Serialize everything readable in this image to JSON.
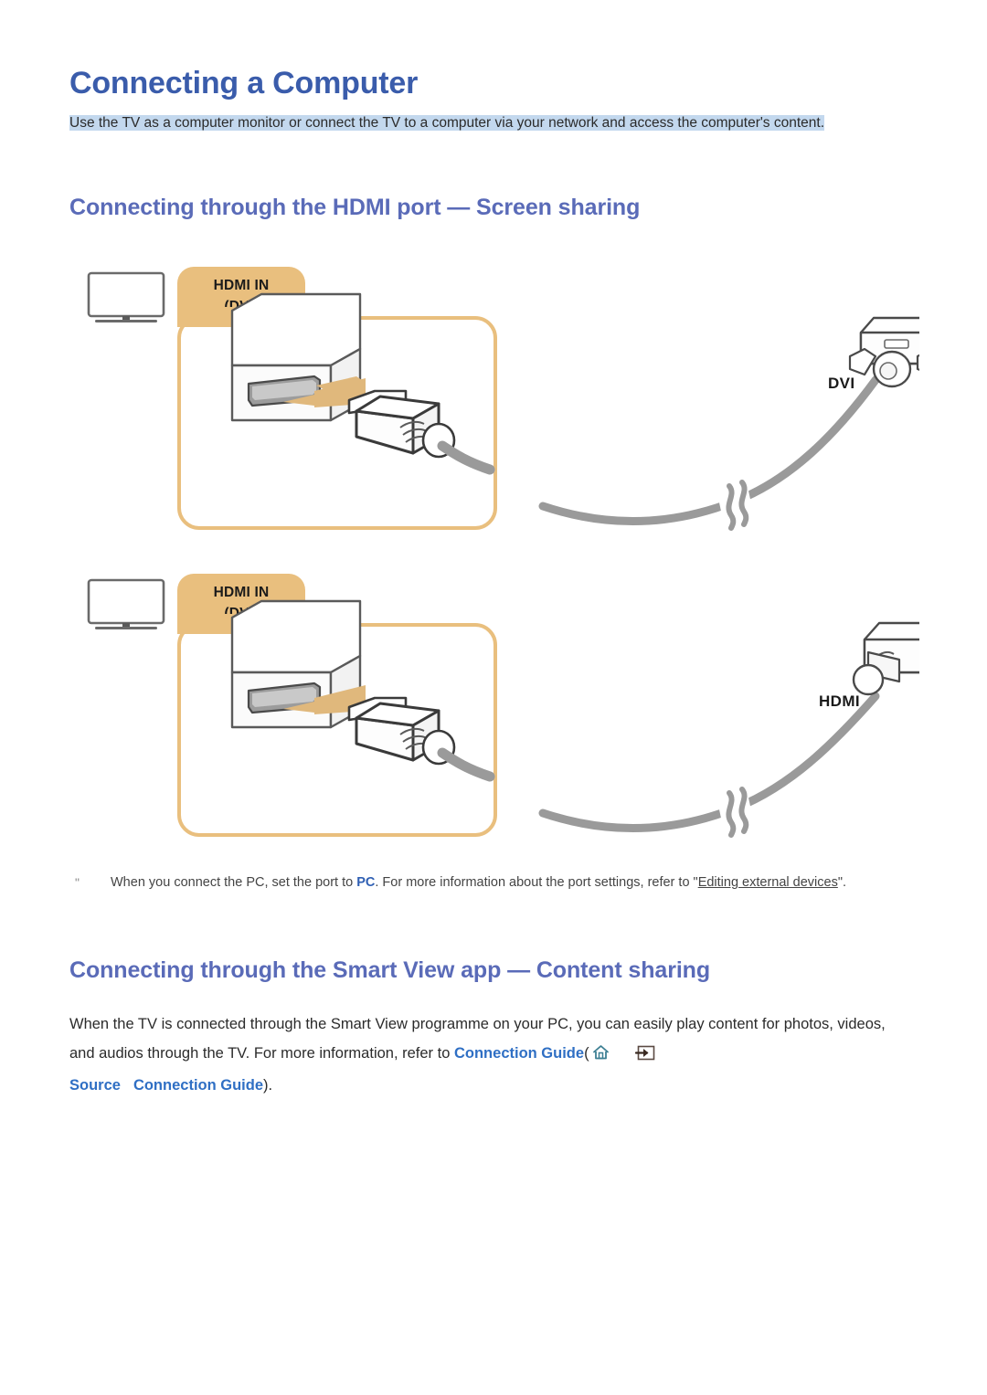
{
  "document": {
    "title": "Connecting a Computer",
    "intro": "Use the TV as a computer monitor or connect the TV to a computer via your network and access the computer's content."
  },
  "sections": [
    {
      "heading": "Connecting through the HDMI port — Screen sharing",
      "diagrams": [
        {
          "id": "dvi",
          "tv_icon": "tv-icon",
          "port_label_line1": "HDMI IN",
          "port_label_line2": "(DVI)",
          "connector_label": "DVI",
          "cable_break_icon": "cable-break-icon"
        },
        {
          "id": "hdmi",
          "tv_icon": "tv-icon",
          "port_label_line1": "HDMI IN",
          "port_label_line2": "(DVI)",
          "connector_label": "HDMI",
          "cable_break_icon": "cable-break-icon"
        }
      ],
      "note": {
        "marker": "\"",
        "text_before": "When you connect the PC, set the port to ",
        "keyword": "PC",
        "text_middle": ". For more information about the port settings, refer to \"",
        "link": "Editing external devices",
        "text_after": "\"."
      }
    },
    {
      "heading": "Connecting through the Smart View app — Content sharing",
      "paragraph": {
        "text_before": "When the TV is connected through the Smart View programme on your PC, you can easily play content for photos, videos, and audios through the TV. For more information, refer to ",
        "link1": "Connection Guide",
        "paren_open": "(",
        "home_icon": "home-icon",
        "source_arrow_icon": "source-arrow-icon",
        "link2": "Source",
        "link3": "Connection Guide",
        "paren_close": ")."
      }
    }
  ],
  "colors": {
    "title_blue": "#3a5cab",
    "section_blue": "#5a6bb8",
    "link_blue": "#2f6fc4",
    "keyword_blue": "#2f5fb3",
    "highlight": "#c3d8ee",
    "tab_gold": "#e9bf7e",
    "cable_gray": "#9a9a9a",
    "home_icon_teal": "#3d7f93"
  }
}
